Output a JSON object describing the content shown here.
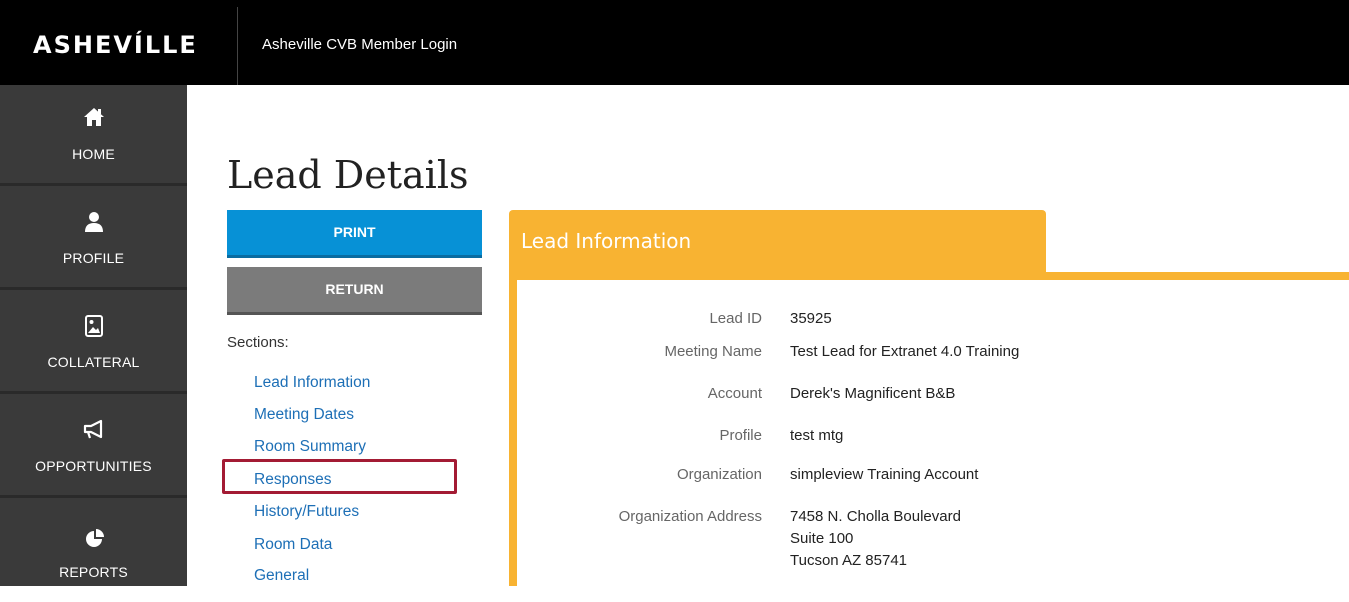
{
  "header": {
    "logo": "ASHEVÍLLE",
    "app_title": "Asheville CVB Member Login"
  },
  "sidebar": {
    "items": [
      {
        "label": "HOME",
        "icon": "home-icon"
      },
      {
        "label": "PROFILE",
        "icon": "user-icon"
      },
      {
        "label": "COLLATERAL",
        "icon": "image-icon"
      },
      {
        "label": "OPPORTUNITIES",
        "icon": "megaphone-icon"
      },
      {
        "label": "REPORTS",
        "icon": "pie-chart-icon"
      }
    ]
  },
  "page": {
    "title": "Lead Details",
    "print_label": "PRINT",
    "return_label": "RETURN",
    "sections_label": "Sections:",
    "sections": [
      "Lead Information",
      "Meeting Dates",
      "Room Summary",
      "Responses",
      "History/Futures",
      "Room Data",
      "General"
    ],
    "highlighted_section": "Responses"
  },
  "lead_info": {
    "tab_title": "Lead Information",
    "fields": [
      {
        "label": "Lead ID",
        "value": "35925"
      },
      {
        "label": "Meeting Name",
        "value": "Test Lead for Extranet 4.0 Training"
      },
      {
        "label": "Account",
        "value": "Derek's Magnificent B&B"
      },
      {
        "label": "Profile",
        "value": "test mtg"
      },
      {
        "label": "Organization",
        "value": "simpleview Training Account"
      },
      {
        "label": "Organization Address",
        "value_lines": [
          "7458 N. Cholla Boulevard",
          "Suite 100",
          "Tucson AZ 85741"
        ]
      }
    ]
  },
  "colors": {
    "print_button": "#0791d6",
    "return_button": "#7b7b7b",
    "panel_accent": "#f8b332",
    "sidebar_bg": "#3a3a3a",
    "highlight_border": "#a31b34",
    "link": "#1d6fb6"
  }
}
